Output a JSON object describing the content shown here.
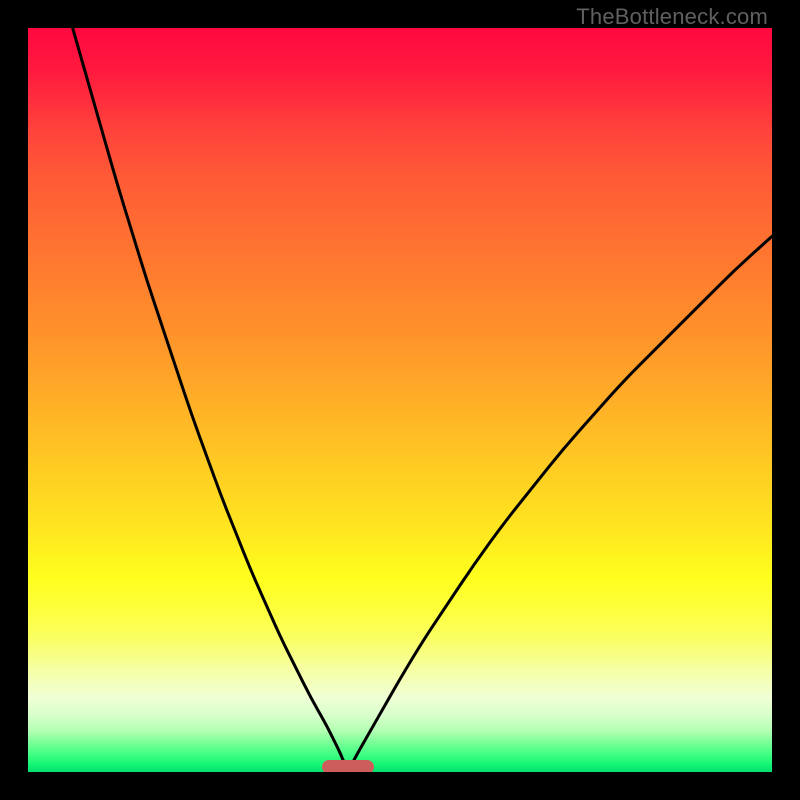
{
  "watermark": "TheBottleneck.com",
  "colors": {
    "curve_stroke": "#000000",
    "marker_fill": "#cd5c5c",
    "frame_bg": "#000000"
  },
  "chart_data": {
    "type": "line",
    "title": "",
    "xlabel": "",
    "ylabel": "",
    "xlim": [
      0,
      100
    ],
    "ylim": [
      0,
      100
    ],
    "optimum_x": 43,
    "marker": {
      "x_center_pct": 43,
      "width_pct": 7
    },
    "series": [
      {
        "name": "left-branch",
        "x": [
          6,
          8,
          10,
          12,
          14,
          16,
          18,
          20,
          22,
          24,
          26,
          28,
          30,
          32,
          34,
          36,
          38,
          40,
          41,
          42,
          43
        ],
        "y": [
          100,
          93,
          86,
          79,
          72.5,
          66,
          60,
          54,
          48,
          42.5,
          37,
          32,
          27,
          22.5,
          18,
          14,
          10,
          6.5,
          4.5,
          2.5,
          0
        ]
      },
      {
        "name": "right-branch",
        "x": [
          43,
          44,
          46,
          48,
          50,
          53,
          56,
          60,
          64,
          68,
          72,
          76,
          80,
          85,
          90,
          95,
          100
        ],
        "y": [
          0,
          2,
          5.5,
          9,
          12.5,
          17.5,
          22,
          28,
          33.5,
          38.5,
          43.5,
          48,
          52.5,
          57.5,
          62.5,
          67.5,
          72
        ]
      }
    ]
  }
}
